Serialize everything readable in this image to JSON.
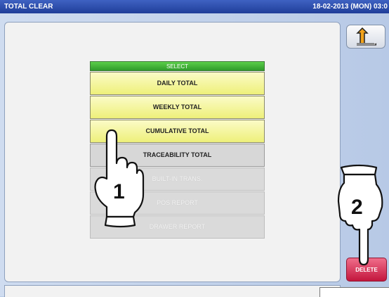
{
  "window": {
    "title": "TOTAL CLEAR",
    "datetime": "18-02-2013 (MON) 03:0"
  },
  "select_list": {
    "header": "SELECT",
    "items": [
      {
        "label": "DAILY TOTAL",
        "state": "active"
      },
      {
        "label": "WEEKLY TOTAL",
        "state": "active"
      },
      {
        "label": "CUMULATIVE TOTAL",
        "state": "active"
      },
      {
        "label": "TRACEABILITY TOTAL",
        "state": "inactive"
      },
      {
        "label": "BUILT-IN TRANS.",
        "state": "disabled"
      },
      {
        "label": "POS REPORT",
        "state": "disabled"
      },
      {
        "label": "DRAWER REPORT",
        "state": "disabled"
      }
    ]
  },
  "buttons": {
    "delete_label": "DELETE",
    "back_icon": "return-arrow-icon"
  },
  "annotations": {
    "step1": "1",
    "step2": "2"
  },
  "colors": {
    "titlebar": "#2b4ba8",
    "header_green": "#3aa832",
    "active_item": "#f3f48f",
    "delete_red": "#d62a50"
  }
}
